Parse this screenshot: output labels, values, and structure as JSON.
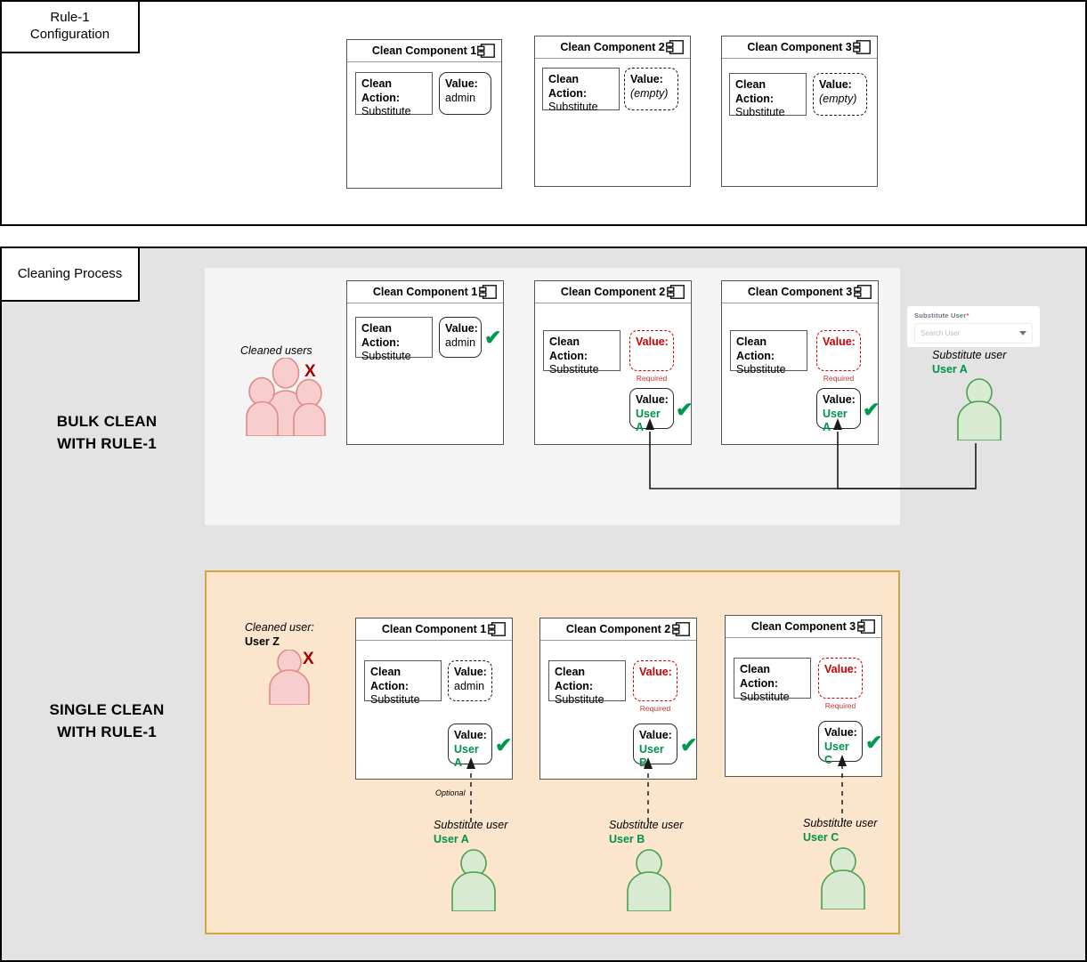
{
  "sections": {
    "rule": {
      "tag": "Rule-1\nConfiguration"
    },
    "process": {
      "tag": "Cleaning Process"
    }
  },
  "side_captions": {
    "bulk": "BULK CLEAN\nWITH RULE-1",
    "single": "SINGLE CLEAN\nWITH RULE-1"
  },
  "labels": {
    "clean_action": "Clean Action:",
    "value": "Value:",
    "required": "Required",
    "optional": "Optional",
    "substitute_user_caption": "Substitute user",
    "cleaned_users_caption": "Cleaned users",
    "cleaned_user_caption": "Cleaned user:",
    "check_glyph": "✔",
    "x_glyph": "X"
  },
  "rule_config": {
    "components": [
      {
        "title": "Clean Component 1",
        "action_label": "Clean Action:",
        "action_value": "Substitute",
        "value_label": "Value:",
        "value_text": "admin",
        "value_style": "round-solid"
      },
      {
        "title": "Clean Component 2",
        "action_label": "Clean Action:",
        "action_value": "Substitute",
        "value_label": "Value:",
        "value_text": "(empty)",
        "value_style": "round-dashed"
      },
      {
        "title": "Clean Component 3",
        "action_label": "Clean Action:",
        "action_value": "Substitute",
        "value_label": "Value:",
        "value_text": "(empty)",
        "value_style": "round-dashed"
      }
    ]
  },
  "bulk_clean": {
    "cleaned_caption": "Cleaned users",
    "components": [
      {
        "title": "Clean Component 1",
        "action_label": "Clean Action:",
        "action_value": "Substitute",
        "value_label": "Value:",
        "value_text": "admin",
        "has_check": true
      },
      {
        "title": "Clean Component 2",
        "action_label": "Clean Action:",
        "action_value": "Substitute",
        "required_label": "Value:",
        "required_note": "Required",
        "resolved_label": "Value:",
        "resolved_value": "User A",
        "has_check": true
      },
      {
        "title": "Clean Component 3",
        "action_label": "Clean Action:",
        "action_value": "Substitute",
        "required_label": "Value:",
        "required_note": "Required",
        "resolved_label": "Value:",
        "resolved_value": "User A",
        "has_check": true
      }
    ],
    "dropdown": {
      "label": "Substitute User",
      "required_marker": "*",
      "placeholder": "Search User"
    },
    "substitute": {
      "caption": "Substitute user",
      "name": "User A"
    }
  },
  "single_clean": {
    "cleaned_caption": "Cleaned user:",
    "cleaned_name": "User Z",
    "components": [
      {
        "title": "Clean Component 1",
        "action_label": "Clean Action:",
        "action_value": "Substitute",
        "default_label": "Value:",
        "default_value": "admin",
        "resolved_label": "Value:",
        "resolved_value": "User A",
        "connector_label": "Optional"
      },
      {
        "title": "Clean Component 2",
        "action_label": "Clean Action:",
        "action_value": "Substitute",
        "required_label": "Value:",
        "required_note": "Required",
        "resolved_label": "Value:",
        "resolved_value": "User B"
      },
      {
        "title": "Clean Component 3",
        "action_label": "Clean Action:",
        "action_value": "Substitute",
        "required_label": "Value:",
        "required_note": "Required",
        "resolved_label": "Value:",
        "resolved_value": "User C"
      }
    ],
    "substitutes": [
      {
        "caption": "Substitute user",
        "name": "User A"
      },
      {
        "caption": "Substitute user",
        "name": "User B"
      },
      {
        "caption": "Substitute user",
        "name": "User C"
      }
    ]
  },
  "colors": {
    "green": "#00924a",
    "red": "#cc0000",
    "dark_red": "#a80000",
    "panel_gray": "#e3e3e3",
    "panel_light": "#f4f4f4",
    "panel_peach": "#fce5cd",
    "panel_peach_border": "#d6a540"
  }
}
